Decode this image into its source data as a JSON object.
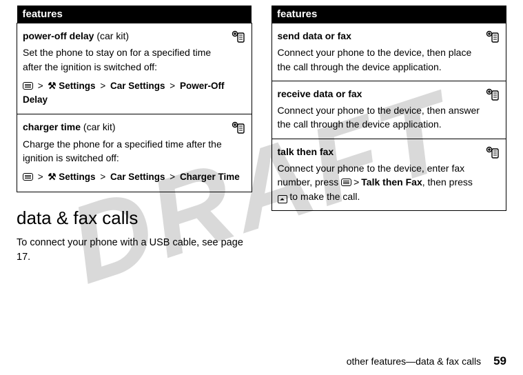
{
  "watermark": "DRAFT",
  "left": {
    "header": "features",
    "rows": [
      {
        "title_bold": "power-off delay",
        "title_rest": " (car kit)",
        "body": "Set the phone to stay on for a specified time after the ignition is switched off:",
        "path": {
          "seg1": "Settings",
          "seg2": "Car Settings",
          "seg3": "Power-Off Delay"
        }
      },
      {
        "title_bold": "charger time",
        "title_rest": " (car kit)",
        "body": "Charge the phone for a specified time after the ignition is switched off:",
        "path": {
          "seg1": "Settings",
          "seg2": "Car Settings",
          "seg3": "Charger Time"
        }
      }
    ],
    "section_title": "data & fax calls",
    "section_body": "To connect your phone with a USB cable, see page 17."
  },
  "right": {
    "header": "features",
    "rows": [
      {
        "title_bold": "send data or fax",
        "body": "Connect your phone to the device, then place the call through the device application."
      },
      {
        "title_bold": "receive data or fax",
        "body": "Connect your phone to the device, then answer the call through the device application."
      },
      {
        "title_bold": "talk then fax",
        "body_pre": "Connect your phone to the device, enter fax number, press ",
        "menu_item": "Talk then Fax",
        "body_post": ", then press ",
        "body_end": " to make the call."
      }
    ]
  },
  "footer": {
    "text": "other features—data & fax calls",
    "page": "59"
  },
  "glyphs": {
    "tools": "⚒",
    "gt": ">",
    "send": "⏶"
  }
}
